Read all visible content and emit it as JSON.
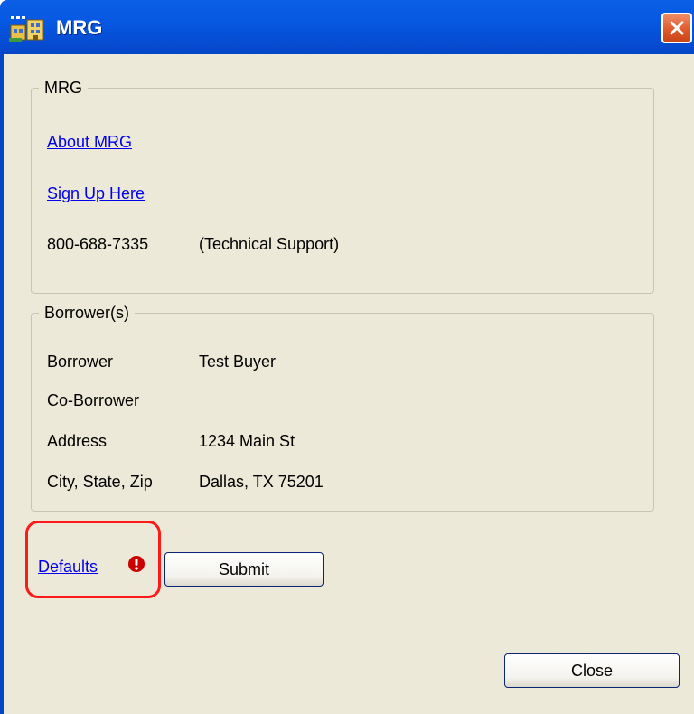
{
  "window": {
    "title": "MRG"
  },
  "mrg_group": {
    "legend": "MRG",
    "about_link": "About MRG",
    "signup_link": "Sign Up Here",
    "phone": "800-688-7335",
    "phone_note": "(Technical Support)"
  },
  "borrower_group": {
    "legend": "Borrower(s)",
    "rows": [
      {
        "label": "Borrower",
        "value": "Test Buyer"
      },
      {
        "label": "Co-Borrower",
        "value": ""
      },
      {
        "label": "Address",
        "value": "1234 Main St"
      },
      {
        "label": "City, State, Zip",
        "value": "Dallas, TX 75201"
      }
    ]
  },
  "actions": {
    "defaults_link": "Defaults",
    "submit_label": "Submit",
    "close_label": "Close"
  },
  "icons": {
    "app": "app-building-icon",
    "close": "close-x-icon",
    "warning": "exclamation-circle-icon"
  },
  "colors": {
    "titlebar": "#0758e2",
    "close_button": "#e15a2c",
    "dialog_bg": "#ece9d8",
    "link": "#0000ee",
    "highlight": "#ff1a1a",
    "warning": "#cc0000"
  }
}
